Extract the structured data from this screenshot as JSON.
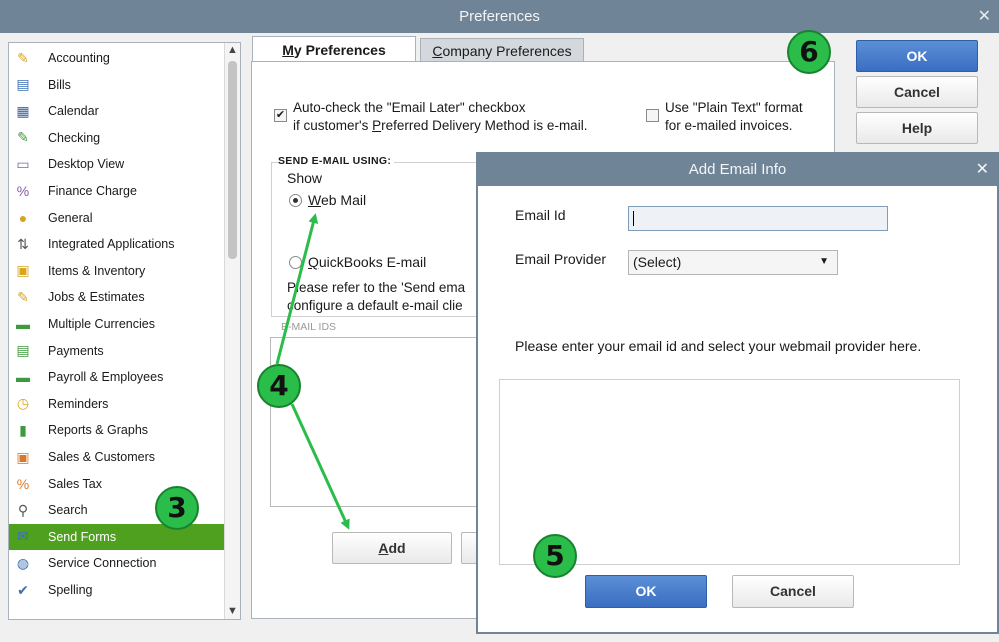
{
  "window": {
    "title": "Preferences",
    "close": "✕"
  },
  "sidebar": {
    "items": [
      {
        "label": "Accounting",
        "icon": "accounting-icon",
        "glyph": "✎",
        "color": "#d9a520"
      },
      {
        "label": "Bills",
        "icon": "bills-icon",
        "glyph": "▤",
        "color": "#3b6fb6"
      },
      {
        "label": "Calendar",
        "icon": "calendar-icon",
        "glyph": "▦",
        "color": "#3b5fa0"
      },
      {
        "label": "Checking",
        "icon": "checking-icon",
        "glyph": "✎",
        "color": "#3f9a3f"
      },
      {
        "label": "Desktop View",
        "icon": "desktop-view-icon",
        "glyph": "▭",
        "color": "#6a6ab8"
      },
      {
        "label": "Finance Charge",
        "icon": "finance-charge-icon",
        "glyph": "%",
        "color": "#8a5aa8"
      },
      {
        "label": "General",
        "icon": "general-icon",
        "glyph": "●",
        "color": "#d9a520"
      },
      {
        "label": "Integrated Applications",
        "icon": "integrated-applications-icon",
        "glyph": "⇅",
        "color": "#555555"
      },
      {
        "label": "Items & Inventory",
        "icon": "items-inventory-icon",
        "glyph": "▣",
        "color": "#d9a520"
      },
      {
        "label": "Jobs & Estimates",
        "icon": "jobs-estimates-icon",
        "glyph": "✎",
        "color": "#d9a520"
      },
      {
        "label": "Multiple Currencies",
        "icon": "multiple-currencies-icon",
        "glyph": "▬",
        "color": "#3f9a3f"
      },
      {
        "label": "Payments",
        "icon": "payments-icon",
        "glyph": "▤",
        "color": "#3f9a3f"
      },
      {
        "label": "Payroll & Employees",
        "icon": "payroll-employees-icon",
        "glyph": "▬",
        "color": "#3f9a3f"
      },
      {
        "label": "Reminders",
        "icon": "reminders-icon",
        "glyph": "◷",
        "color": "#d9a520"
      },
      {
        "label": "Reports & Graphs",
        "icon": "reports-graphs-icon",
        "glyph": "▮",
        "color": "#3f9a3f"
      },
      {
        "label": "Sales & Customers",
        "icon": "sales-customers-icon",
        "glyph": "▣",
        "color": "#d9782a"
      },
      {
        "label": "Sales Tax",
        "icon": "sales-tax-icon",
        "glyph": "%",
        "color": "#d9782a"
      },
      {
        "label": "Search",
        "icon": "search-icon",
        "glyph": "⚲",
        "color": "#555555"
      },
      {
        "label": "Send Forms",
        "icon": "send-forms-icon",
        "glyph": "✉",
        "color": "#3b6fb6"
      },
      {
        "label": "Service Connection",
        "icon": "service-connection-icon",
        "glyph": "◍",
        "color": "#3b6fb6"
      },
      {
        "label": "Spelling",
        "icon": "spelling-icon",
        "glyph": "✔",
        "color": "#3b6fb6"
      }
    ],
    "scroll_up": "▲",
    "scroll_down": "▼"
  },
  "tabs": {
    "my": {
      "pre": "",
      "u": "M",
      "post": "y Preferences"
    },
    "company": {
      "pre": "",
      "u": "C",
      "post": "ompany Preferences"
    }
  },
  "prefs": {
    "auto_check_line1": "Auto-check the \"Email Later\" checkbox",
    "auto_check_line2_pre": "if customer's ",
    "auto_check_line2_u": "P",
    "auto_check_line2_post": "referred Delivery Method is e-mail.",
    "plain_text_line1": "Use \"Plain Text\" format",
    "plain_text_line2": "for e-mailed invoices.",
    "check_mark": "✔"
  },
  "send": {
    "legend": "SEND E-MAIL USING:",
    "show": "Show",
    "webmail_u": "W",
    "webmail_rest": "eb Mail",
    "qb_u": "Q",
    "qb_rest": "uickBooks E-mail",
    "note_line1": "Please refer to the 'Send ema",
    "note_line2": "configure a default e-mail clie",
    "email_ids": "E-MAIL IDS"
  },
  "buttons": {
    "ok": "OK",
    "cancel": "Cancel",
    "help": "Help",
    "add_u": "A",
    "add_rest": "dd"
  },
  "dialog": {
    "title": "Add Email Info",
    "close": "✕",
    "email_id_label": "Email Id",
    "email_id_value": "",
    "provider_label": "Email Provider",
    "provider_value": "(Select)",
    "dropdown_arrow": "▼",
    "hint": "Please enter your email id and select your webmail provider here.",
    "ok": "OK",
    "cancel": "Cancel"
  },
  "callouts": {
    "b3": "3",
    "b4": "4",
    "b5": "5",
    "b6": "6"
  },
  "colors": {
    "accent_green": "#4fa01e",
    "title_bar": "#6f8496",
    "callout_green": "#2bbd49",
    "ok_blue": "#3a6ec2"
  }
}
